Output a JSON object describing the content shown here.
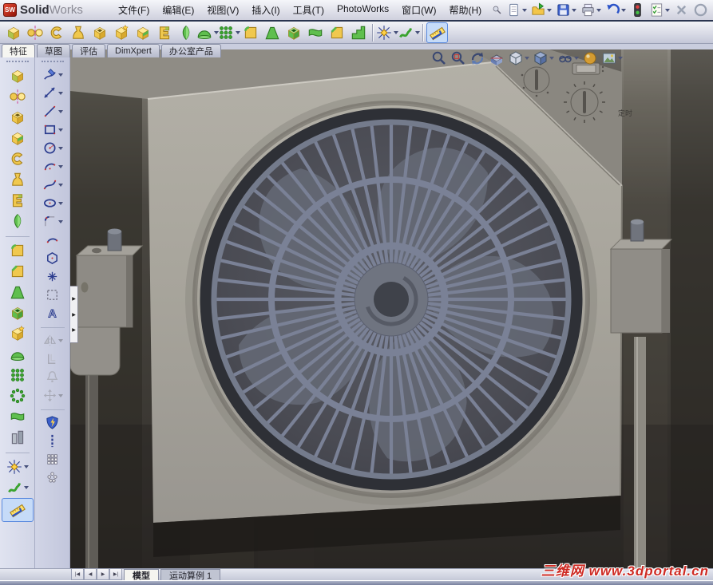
{
  "window": {
    "logo_sw": "SW",
    "logo_bold": "Solid",
    "logo_light": "Works"
  },
  "menu_bar": {
    "items": [
      "文件(F)",
      "编辑(E)",
      "视图(V)",
      "插入(I)",
      "工具(T)",
      "PhotoWorks",
      "窗口(W)",
      "帮助(H)"
    ]
  },
  "standard_toolbar": {
    "items": [
      {
        "name": "new-document",
        "icon": "page",
        "dd": true
      },
      {
        "name": "open-document",
        "icon": "folder",
        "dd": true
      },
      {
        "name": "save",
        "icon": "floppy",
        "dd": true
      },
      {
        "name": "print",
        "icon": "printer",
        "dd": true
      },
      {
        "name": "undo",
        "icon": "undo",
        "dd": true
      },
      {
        "name": "toolbars-toggle",
        "icon": "traffic",
        "dd": false
      },
      {
        "name": "selection-filter",
        "icon": "list",
        "dd": true
      },
      {
        "name": "close-document",
        "icon": "xmark",
        "dd": false
      },
      {
        "name": "rebuild",
        "icon": "partial",
        "dd": false
      }
    ]
  },
  "command_manager": {
    "tabs": [
      {
        "label": "特征",
        "active": true
      },
      {
        "label": "草图",
        "active": false
      },
      {
        "label": "评估",
        "active": false
      },
      {
        "label": "DimXpert",
        "active": false
      },
      {
        "label": "办公室产品",
        "active": false
      }
    ]
  },
  "features_toolbar": {
    "items": [
      {
        "name": "extruded-boss",
        "icon": "cubeY"
      },
      {
        "name": "revolved-boss",
        "icon": "dumbbell"
      },
      {
        "name": "swept-boss",
        "icon": "cshape"
      },
      {
        "name": "lofted-boss",
        "icon": "bell"
      },
      {
        "name": "extruded-cut",
        "icon": "cutY"
      },
      {
        "name": "hole-wizard",
        "icon": "wizard"
      },
      {
        "name": "revolved-cut",
        "icon": "notch"
      },
      {
        "name": "swept-cut",
        "icon": "eshape"
      },
      {
        "name": "lofted-cut",
        "icon": "leaf"
      },
      {
        "name": "dome",
        "icon": "domeG",
        "dd": true
      },
      {
        "name": "linear-pattern",
        "icon": "dots3",
        "dd": true
      },
      {
        "name": "fillet",
        "icon": "filletY"
      },
      {
        "name": "rib",
        "icon": "ribG"
      },
      {
        "name": "shell",
        "icon": "shellG"
      },
      {
        "name": "wrap",
        "icon": "wrapG"
      },
      {
        "name": "chamfer",
        "icon": "chamferY"
      },
      {
        "name": "flex",
        "icon": "stepsG"
      },
      {
        "sep": true
      },
      {
        "name": "reference-geometry",
        "icon": "star",
        "dd": true
      },
      {
        "name": "curves",
        "icon": "squig",
        "dd": true
      },
      {
        "sep": true
      },
      {
        "name": "instant3d",
        "icon": "ruler",
        "selected": true
      }
    ]
  },
  "sidebar": {
    "features_column": {
      "items": [
        {
          "name": "extruded-boss",
          "icon": "cubeY"
        },
        {
          "name": "revolved-boss",
          "icon": "dumbbell"
        },
        {
          "name": "extruded-cut",
          "icon": "cutY"
        },
        {
          "name": "revolved-cut",
          "icon": "notch"
        },
        {
          "name": "swept-boss",
          "icon": "cshape"
        },
        {
          "name": "lofted-boss",
          "icon": "bell"
        },
        {
          "name": "swept-cut",
          "icon": "eshape"
        },
        {
          "name": "lofted-cut",
          "icon": "leaf"
        },
        {
          "sep": true
        },
        {
          "name": "fillet",
          "icon": "filletY"
        },
        {
          "name": "chamfer",
          "icon": "chamferY"
        },
        {
          "name": "draft",
          "icon": "ribG"
        },
        {
          "name": "shell",
          "icon": "shellG"
        },
        {
          "name": "hole-wizard",
          "icon": "wizard"
        },
        {
          "name": "dome",
          "icon": "domeG"
        },
        {
          "name": "linear-pattern",
          "icon": "dots3"
        },
        {
          "name": "circular-pattern",
          "icon": "dotsC"
        },
        {
          "name": "wrap",
          "icon": "wrapG"
        },
        {
          "name": "mirror",
          "icon": "buildG"
        },
        {
          "sep": true
        },
        {
          "name": "reference-geometry",
          "icon": "star",
          "dd": true
        },
        {
          "name": "curves",
          "icon": "squig",
          "dd": true
        },
        {
          "name": "instant3d",
          "icon": "ruler",
          "selected": true
        }
      ]
    },
    "sketch_column": {
      "items": [
        {
          "name": "sketch",
          "icon": "pencil",
          "dd": true
        },
        {
          "name": "smart-dimension",
          "icon": "dim",
          "dd": true
        },
        {
          "name": "line",
          "icon": "sline",
          "dd": true
        },
        {
          "name": "corner-rectangle",
          "icon": "srect",
          "dd": true
        },
        {
          "name": "circle",
          "icon": "scircle",
          "dd": true
        },
        {
          "name": "centerpoint-arc",
          "icon": "sarc",
          "dd": true
        },
        {
          "name": "spline",
          "icon": "sspline",
          "dd": true
        },
        {
          "name": "ellipse",
          "icon": "sellipse",
          "dd": true
        },
        {
          "name": "sketch-fillet",
          "icon": "sfillet",
          "dd": true
        },
        {
          "name": "tangent-arc",
          "icon": "sarc3"
        },
        {
          "name": "polygon",
          "icon": "shex"
        },
        {
          "name": "point",
          "icon": "spoint"
        },
        {
          "name": "trim-entities",
          "icon": "sdash"
        },
        {
          "name": "text",
          "icon": "stext"
        },
        {
          "sep": true
        },
        {
          "name": "mirror-entities",
          "icon": "smirror",
          "dd": true,
          "disabled": true
        },
        {
          "name": "offset-entities",
          "icon": "soffset",
          "disabled": true
        },
        {
          "name": "add-relation",
          "icon": "sbell",
          "disabled": true
        },
        {
          "name": "move-entities",
          "icon": "smove",
          "dd": true,
          "disabled": true
        },
        {
          "sep": true
        },
        {
          "name": "quick-snaps",
          "icon": "sshield"
        },
        {
          "name": "rapid-sketch",
          "icon": "sdashv"
        },
        {
          "name": "linear-sketch-pattern",
          "icon": "sgrid"
        },
        {
          "name": "circular-sketch-pattern",
          "icon": "sdots"
        }
      ]
    }
  },
  "headsup_toolbar": {
    "items": [
      {
        "name": "zoom-to-fit",
        "icon": "magnifier"
      },
      {
        "name": "zoom-to-area",
        "icon": "magarea"
      },
      {
        "name": "rotate-view",
        "icon": "rotate"
      },
      {
        "name": "section-view",
        "icon": "section"
      },
      {
        "name": "view-orientation",
        "icon": "viewcube",
        "dd": true
      },
      {
        "name": "display-style",
        "icon": "dispcube",
        "dd": true
      },
      {
        "name": "hide-show-items",
        "icon": "hideshow",
        "dd": true
      },
      {
        "name": "edit-appearance",
        "icon": "sphere"
      },
      {
        "name": "apply-scene",
        "icon": "scene",
        "dd": true
      }
    ]
  },
  "viewport": {
    "fan": {
      "spokes": 56,
      "blades": 5,
      "timer_label": "定时"
    }
  },
  "bottom_bar": {
    "nav": [
      "first",
      "previous",
      "next",
      "last"
    ],
    "tabs": [
      {
        "label": "模型",
        "active": true
      },
      {
        "label": "运动算例 1",
        "active": false
      }
    ]
  },
  "watermark": {
    "text": "三维网 www.3dportal.cn",
    "color": "#ce2b24"
  },
  "colors": {
    "selection_blue": "#c6dbf8",
    "viewport_background": "#44413c",
    "housing_grey": "#a9a69d",
    "grille_grey": "#7a8196",
    "titlebar_border": "#2a3550"
  }
}
